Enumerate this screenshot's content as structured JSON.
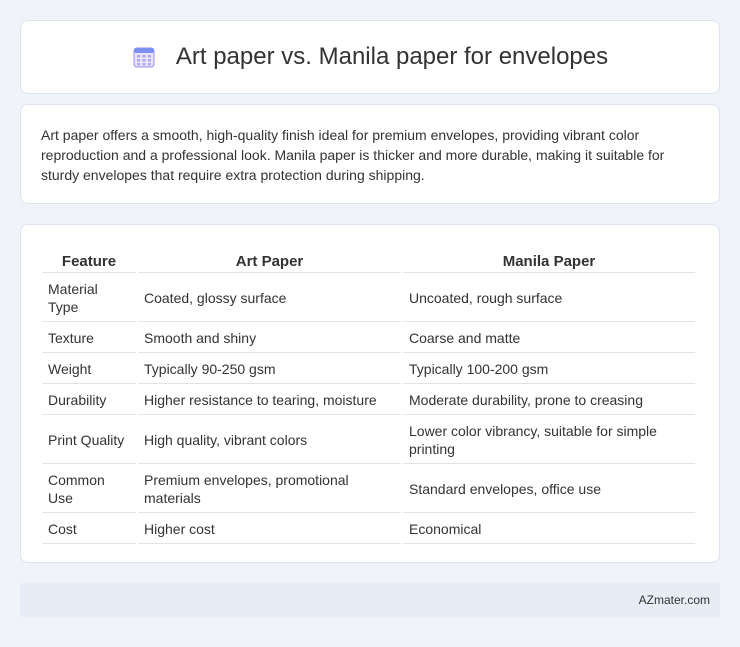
{
  "header": {
    "title": "Art paper vs. Manila paper for envelopes",
    "icon": "calendar-icon"
  },
  "description": "Art paper offers a smooth, high-quality finish ideal for premium envelopes, providing vibrant color reproduction and a professional look. Manila paper is thicker and more durable, making it suitable for sturdy envelopes that require extra protection during shipping.",
  "table": {
    "headers": [
      "Feature",
      "Art Paper",
      "Manila Paper"
    ],
    "rows": [
      [
        "Material Type",
        "Coated, glossy surface",
        "Uncoated, rough surface"
      ],
      [
        "Texture",
        "Smooth and shiny",
        "Coarse and matte"
      ],
      [
        "Weight",
        "Typically 90-250 gsm",
        "Typically 100-200 gsm"
      ],
      [
        "Durability",
        "Higher resistance to tearing, moisture",
        "Moderate durability, prone to creasing"
      ],
      [
        "Print Quality",
        "High quality, vibrant colors",
        "Lower color vibrancy, suitable for simple printing"
      ],
      [
        "Common Use",
        "Premium envelopes, promotional materials",
        "Standard envelopes, office use"
      ],
      [
        "Cost",
        "Higher cost",
        "Economical"
      ]
    ]
  },
  "footer": {
    "site": "AZmater.com"
  }
}
